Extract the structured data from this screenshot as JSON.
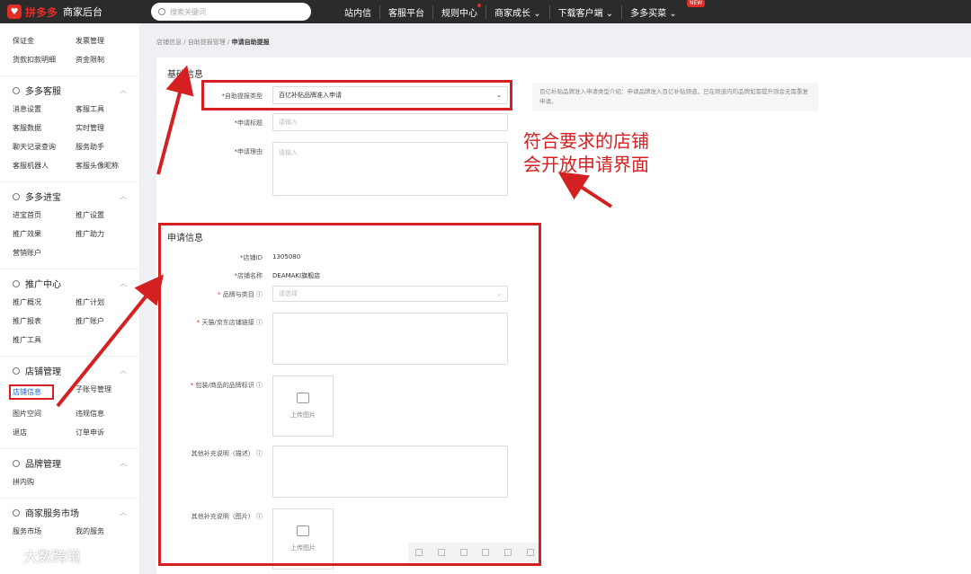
{
  "topbar": {
    "brand": "拼多多",
    "subtitle": "商家后台",
    "search_placeholder": "搜索关键词",
    "nav": [
      "站内信",
      "客服平台",
      "规则中心",
      "商家成长",
      "下载客户端",
      "多多买菜"
    ],
    "new_badge": "NEW"
  },
  "sidebar": {
    "top_items": [
      "保证金",
      "发票管理",
      "货款扣款明细",
      "资金限制"
    ],
    "sections": [
      {
        "title": "多多客服",
        "items": [
          "消息设置",
          "客服工具",
          "客服数据",
          "实时管理",
          "聊天记录查询",
          "服务助手",
          "客服机器人",
          "客服头像昵称"
        ]
      },
      {
        "title": "多多进宝",
        "items": [
          "进宝首页",
          "推广设置",
          "推广效果",
          "推广助力",
          "营销账户"
        ]
      },
      {
        "title": "推广中心",
        "items": [
          "推广概况",
          "推广计划",
          "推广报表",
          "推广账户",
          "推广工具"
        ]
      },
      {
        "title": "店铺管理",
        "items": [
          "店铺信息",
          "子账号管理",
          "图片空间",
          "违规信息",
          "退店",
          "订单申诉"
        ]
      },
      {
        "title": "品牌管理",
        "items": [
          "拼内购"
        ]
      },
      {
        "title": "商家服务市场",
        "items": [
          "服务市场",
          "我的服务"
        ]
      }
    ]
  },
  "breadcrumb": {
    "a": "店铺信息",
    "b": "自助提报管理",
    "c": "申请自助提报"
  },
  "basic": {
    "title": "基础信息",
    "type_label": "*自助提报类型",
    "type_value": "百亿补贴品牌准入申请",
    "title_label": "*申请标题",
    "title_placeholder": "请输入",
    "reason_label": "*申请理由",
    "reason_placeholder": "请输入",
    "info_text": "百亿补贴品牌准入申请类型介绍：申请品牌准入百亿补贴频道，已在频道内的品牌如需提升则会无需重复申请。"
  },
  "apply": {
    "title": "申请信息",
    "shop_id_label": "*店铺ID",
    "shop_id": "1305080",
    "shop_name_label": "*店铺名称",
    "shop_name": "DEAMAKI旗舰店",
    "brand_label": "品牌与类目",
    "brand_placeholder": "请选择",
    "link_label": "天猫/京东店铺链接",
    "logo_label": "包装/商品的品牌标识",
    "upload_label": "上传图片",
    "other_desc_label": "其他补充说明（描述）",
    "other_img_label": "其他补充说明（图片）"
  },
  "annotation": {
    "line1": "符合要求的店铺",
    "line2": "会开放申请界面"
  },
  "watermark": "大数跨境",
  "colors": {
    "accent": "#d42020",
    "brand": "#e02e24",
    "link": "#1a66e0"
  }
}
